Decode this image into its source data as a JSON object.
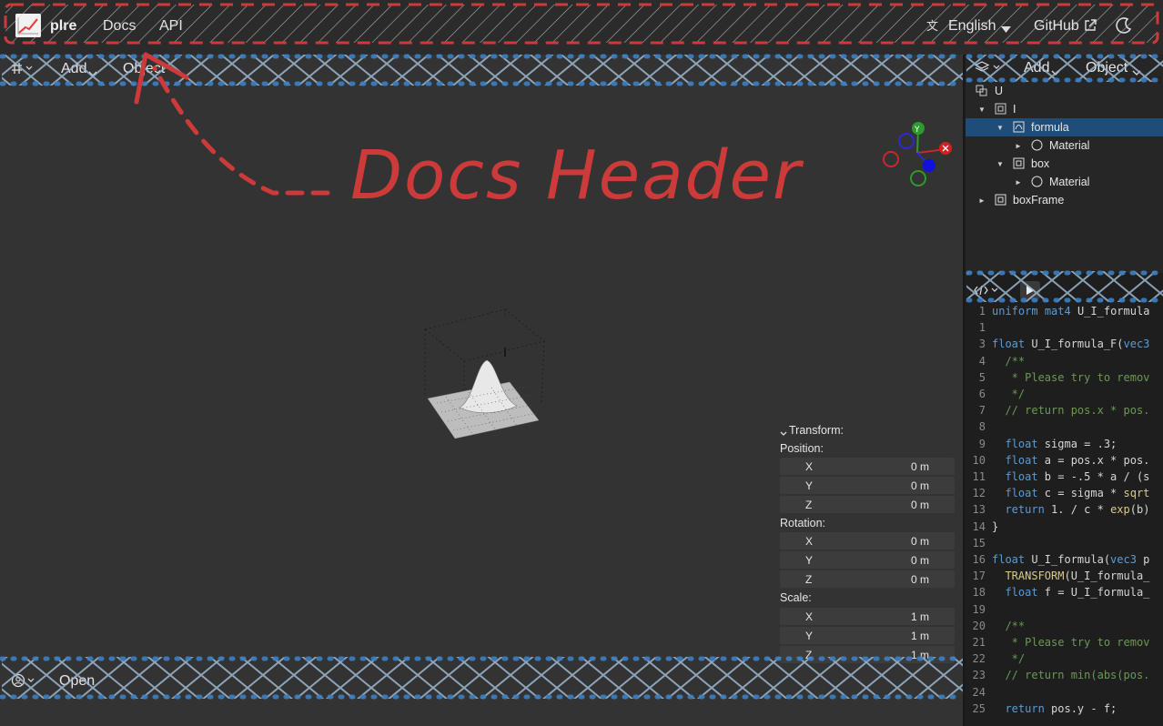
{
  "header": {
    "brand": "plre",
    "nav": [
      "Docs",
      "API"
    ],
    "language": "English",
    "github": "GitHub",
    "icons": [
      "logo-icon",
      "translate-icon",
      "external-link-icon",
      "moon-icon"
    ]
  },
  "viewport_toolbar": {
    "grid_icon": "grid-icon",
    "add": "Add",
    "object": "Object"
  },
  "viewport_bottom": {
    "open": "Open"
  },
  "outliner": {
    "toolbar": {
      "add": "Add",
      "object": "Object"
    },
    "items": [
      {
        "label": "U"
      },
      {
        "label": "I"
      },
      {
        "label": "formula"
      },
      {
        "label": "Material"
      },
      {
        "label": "box"
      },
      {
        "label": "Material"
      },
      {
        "label": "boxFrame"
      }
    ]
  },
  "transform": {
    "title": "Transform:",
    "position_label": "Position:",
    "rotation_label": "Rotation:",
    "scale_label": "Scale:",
    "position": [
      {
        "axis": "X",
        "value": "0 m"
      },
      {
        "axis": "Y",
        "value": "0 m"
      },
      {
        "axis": "Z",
        "value": "0 m"
      }
    ],
    "rotation": [
      {
        "axis": "X",
        "value": "0 m"
      },
      {
        "axis": "Y",
        "value": "0 m"
      },
      {
        "axis": "Z",
        "value": "0 m"
      }
    ],
    "scale": [
      {
        "axis": "X",
        "value": "1 m"
      },
      {
        "axis": "Y",
        "value": "1 m"
      },
      {
        "axis": "Z",
        "value": "1 m"
      }
    ]
  },
  "gizmo": {
    "y": "Y"
  },
  "code": [
    {
      "n": "1",
      "t": "uniform mat4 U_I_formula"
    },
    {
      "n": "1",
      "t": ""
    },
    {
      "n": "3",
      "t": "float U_I_formula_F(vec3"
    },
    {
      "n": "4",
      "t": "  /**"
    },
    {
      "n": "5",
      "t": "   * Please try to remov"
    },
    {
      "n": "6",
      "t": "   */"
    },
    {
      "n": "7",
      "t": "  // return pos.x * pos."
    },
    {
      "n": "8",
      "t": ""
    },
    {
      "n": "9",
      "t": "  float sigma = .3;"
    },
    {
      "n": "10",
      "t": "  float a = pos.x * pos."
    },
    {
      "n": "11",
      "t": "  float b = -.5 * a / (s"
    },
    {
      "n": "12",
      "t": "  float c = sigma * sqrt"
    },
    {
      "n": "13",
      "t": "  return 1. / c * exp(b)"
    },
    {
      "n": "14",
      "t": "}"
    },
    {
      "n": "15",
      "t": ""
    },
    {
      "n": "16",
      "t": "float U_I_formula(vec3 p"
    },
    {
      "n": "17",
      "t": "  TRANSFORM(U_I_formula_"
    },
    {
      "n": "18",
      "t": "  float f = U_I_formula_"
    },
    {
      "n": "19",
      "t": ""
    },
    {
      "n": "20",
      "t": "  /**"
    },
    {
      "n": "21",
      "t": "   * Please try to remov"
    },
    {
      "n": "22",
      "t": "   */"
    },
    {
      "n": "23",
      "t": "  // return min(abs(pos."
    },
    {
      "n": "24",
      "t": ""
    },
    {
      "n": "25",
      "t": "  return pos.y - f;"
    }
  ],
  "annotation": {
    "text": "Docs Header"
  },
  "colors": {
    "annotation": "#cc3a3a",
    "selection": "#1f4d7a",
    "accent_blue": "#2f6fb0"
  }
}
